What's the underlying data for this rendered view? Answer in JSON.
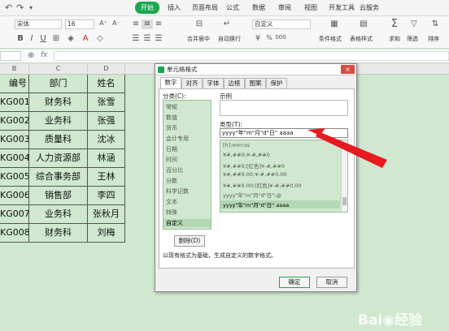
{
  "app": {
    "accent": "#1aa84f",
    "menu_tabs": [
      "开始",
      "插入",
      "页面布局",
      "公式",
      "数据",
      "审阅",
      "视图",
      "开发工具",
      "云服务"
    ],
    "active_tab": "开始"
  },
  "ribbon": {
    "font_name": "宋体",
    "font_size": "16",
    "number_format": "自定义",
    "merge_center": "合并居中",
    "auto_wrap": "自动换行",
    "conditional_format": "条件格式",
    "table_style": "表格样式",
    "sum": "求和",
    "filter": "筛选",
    "sort": "排序",
    "percent_label": "%",
    "thousands_label": "000"
  },
  "formula_bar": {
    "fx": "fx"
  },
  "sheet": {
    "col_headers": [
      "B",
      "C",
      "D"
    ],
    "rows": [
      [
        "编号",
        "部门",
        "姓名"
      ],
      [
        "KG001",
        "财务科",
        "张雪"
      ],
      [
        "KG002",
        "业务科",
        "张强"
      ],
      [
        "KG003",
        "质量科",
        "沈冰"
      ],
      [
        "KG004",
        "人力资源部",
        "林涵"
      ],
      [
        "KG005",
        "综合事务部",
        "王林"
      ],
      [
        "KG006",
        "销售部",
        "李四"
      ],
      [
        "KG007",
        "业务科",
        "张秋月"
      ],
      [
        "KG008",
        "财务科",
        "刘梅"
      ]
    ]
  },
  "dialog": {
    "title": "单元格格式",
    "close_icon": "×",
    "tabs": [
      "数字",
      "对齐",
      "字体",
      "边框",
      "图案",
      "保护"
    ],
    "active_tab": "数字",
    "category_label": "分类(C):",
    "categories": [
      "常规",
      "数值",
      "货币",
      "会计专用",
      "日期",
      "时间",
      "百分比",
      "分数",
      "科学记数",
      "文本",
      "特殊",
      "自定义"
    ],
    "selected_category": "自定义",
    "sample_label": "示例",
    "type_label": "类型(T):",
    "type_value": "yyyy\"年\"m\"月\"d\"日\" aaaa",
    "type_list": [
      "[h]:mm:ss",
      "¥#,##0;¥-#,##0",
      "¥#,##0;[红色]¥-#,##0",
      "¥#,##0.00;¥-#,##0.00",
      "¥#,##0.00;[红色]¥-#,##0.00",
      "yyyy\"年\"m\"月\"d\"日\";@",
      "yyyy\"年\"m\"月\"d\"日\" aaaa"
    ],
    "delete_button": "删除(D)",
    "description": "以现有格式为基础，生成自定义的数字格式。",
    "ok_button": "确定",
    "cancel_button": "取消"
  }
}
